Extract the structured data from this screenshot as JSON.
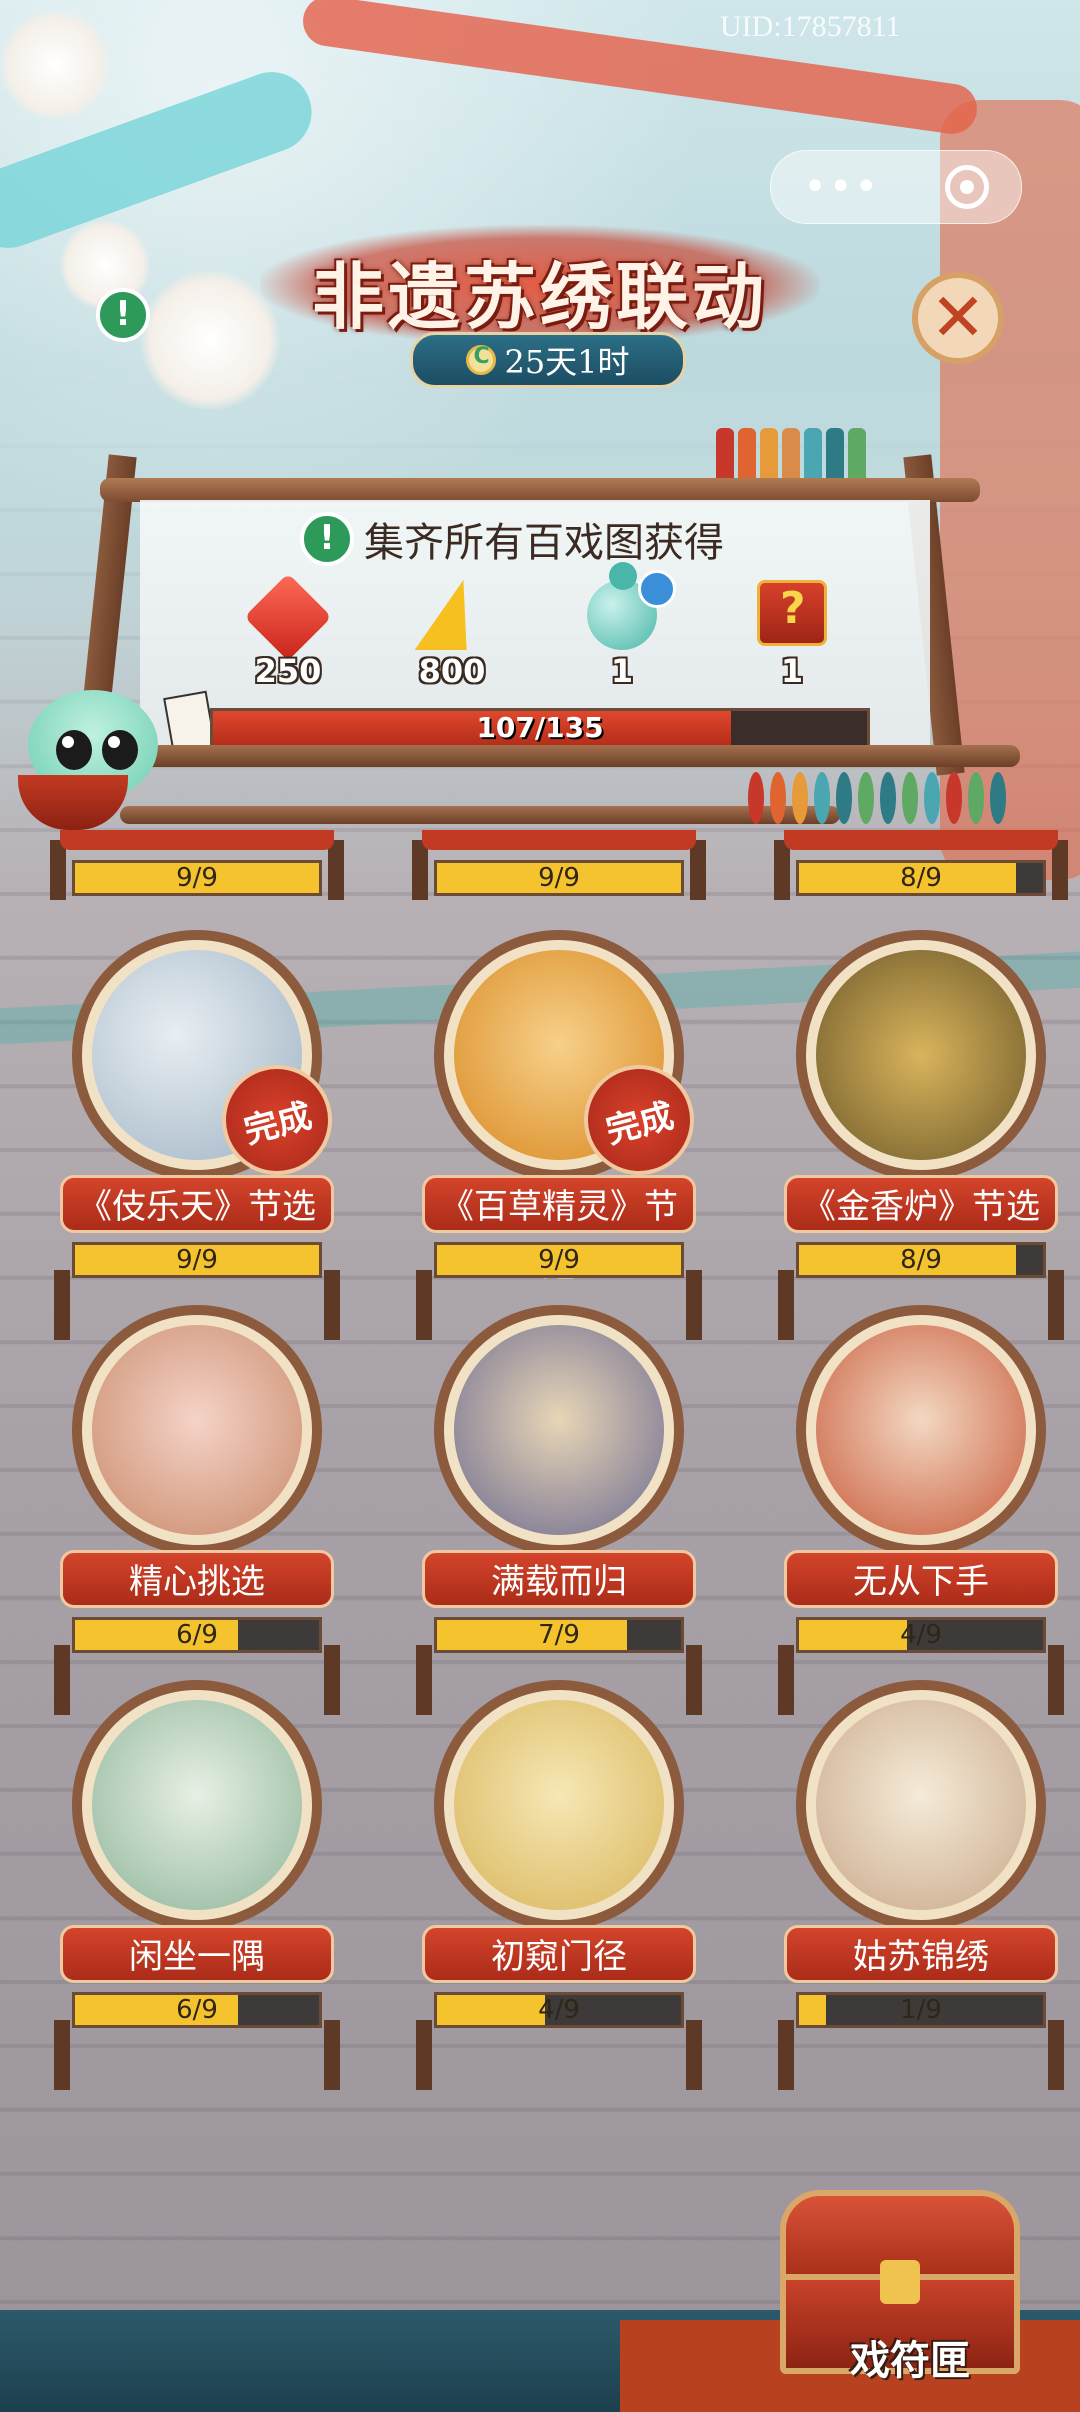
{
  "uid": "UID:17857811",
  "title": "非遗苏绣联动",
  "timer": "25天1时",
  "reward_panel": {
    "header": "集齐所有百戏图获得",
    "rewards": [
      {
        "icon": "red-gem-icon",
        "qty": "250"
      },
      {
        "icon": "lightning-icon",
        "qty": "800"
      },
      {
        "icon": "jade-gourd-icon",
        "qty": "1"
      },
      {
        "icon": "mystery-box-icon",
        "qty": "1"
      }
    ],
    "progress_text": "107/135",
    "progress_value": 0.7926
  },
  "top_row_partial": [
    {
      "progress": "9/9",
      "fraction": 1.0
    },
    {
      "progress": "9/9",
      "fraction": 1.0
    },
    {
      "progress": "8/9",
      "fraction": 0.8889
    }
  ],
  "cards": [
    {
      "name": "《伎乐天》节选",
      "progress": "9/9",
      "fraction": 1.0,
      "badge": "完成"
    },
    {
      "name": "《百草精灵》节选",
      "progress": "9/9",
      "fraction": 1.0,
      "badge": "完成"
    },
    {
      "name": "《金香炉》节选",
      "progress": "8/9",
      "fraction": 0.8889,
      "badge": ""
    },
    {
      "name": "精心挑选",
      "progress": "6/9",
      "fraction": 0.6667,
      "badge": ""
    },
    {
      "name": "满载而归",
      "progress": "7/9",
      "fraction": 0.7778,
      "badge": ""
    },
    {
      "name": "无从下手",
      "progress": "4/9",
      "fraction": 0.4444,
      "badge": ""
    },
    {
      "name": "闲坐一隅",
      "progress": "6/9",
      "fraction": 0.6667,
      "badge": ""
    },
    {
      "name": "初窥门径",
      "progress": "4/9",
      "fraction": 0.4444,
      "badge": ""
    },
    {
      "name": "姑苏锦绣",
      "progress": "1/9",
      "fraction": 0.1111,
      "badge": ""
    }
  ],
  "chest_label": "戏符匣",
  "colors": {
    "accent_red": "#c9341f",
    "progress_yellow": "#f5c32d",
    "teal": "#2c6f86",
    "wood": "#8c5a3d"
  }
}
